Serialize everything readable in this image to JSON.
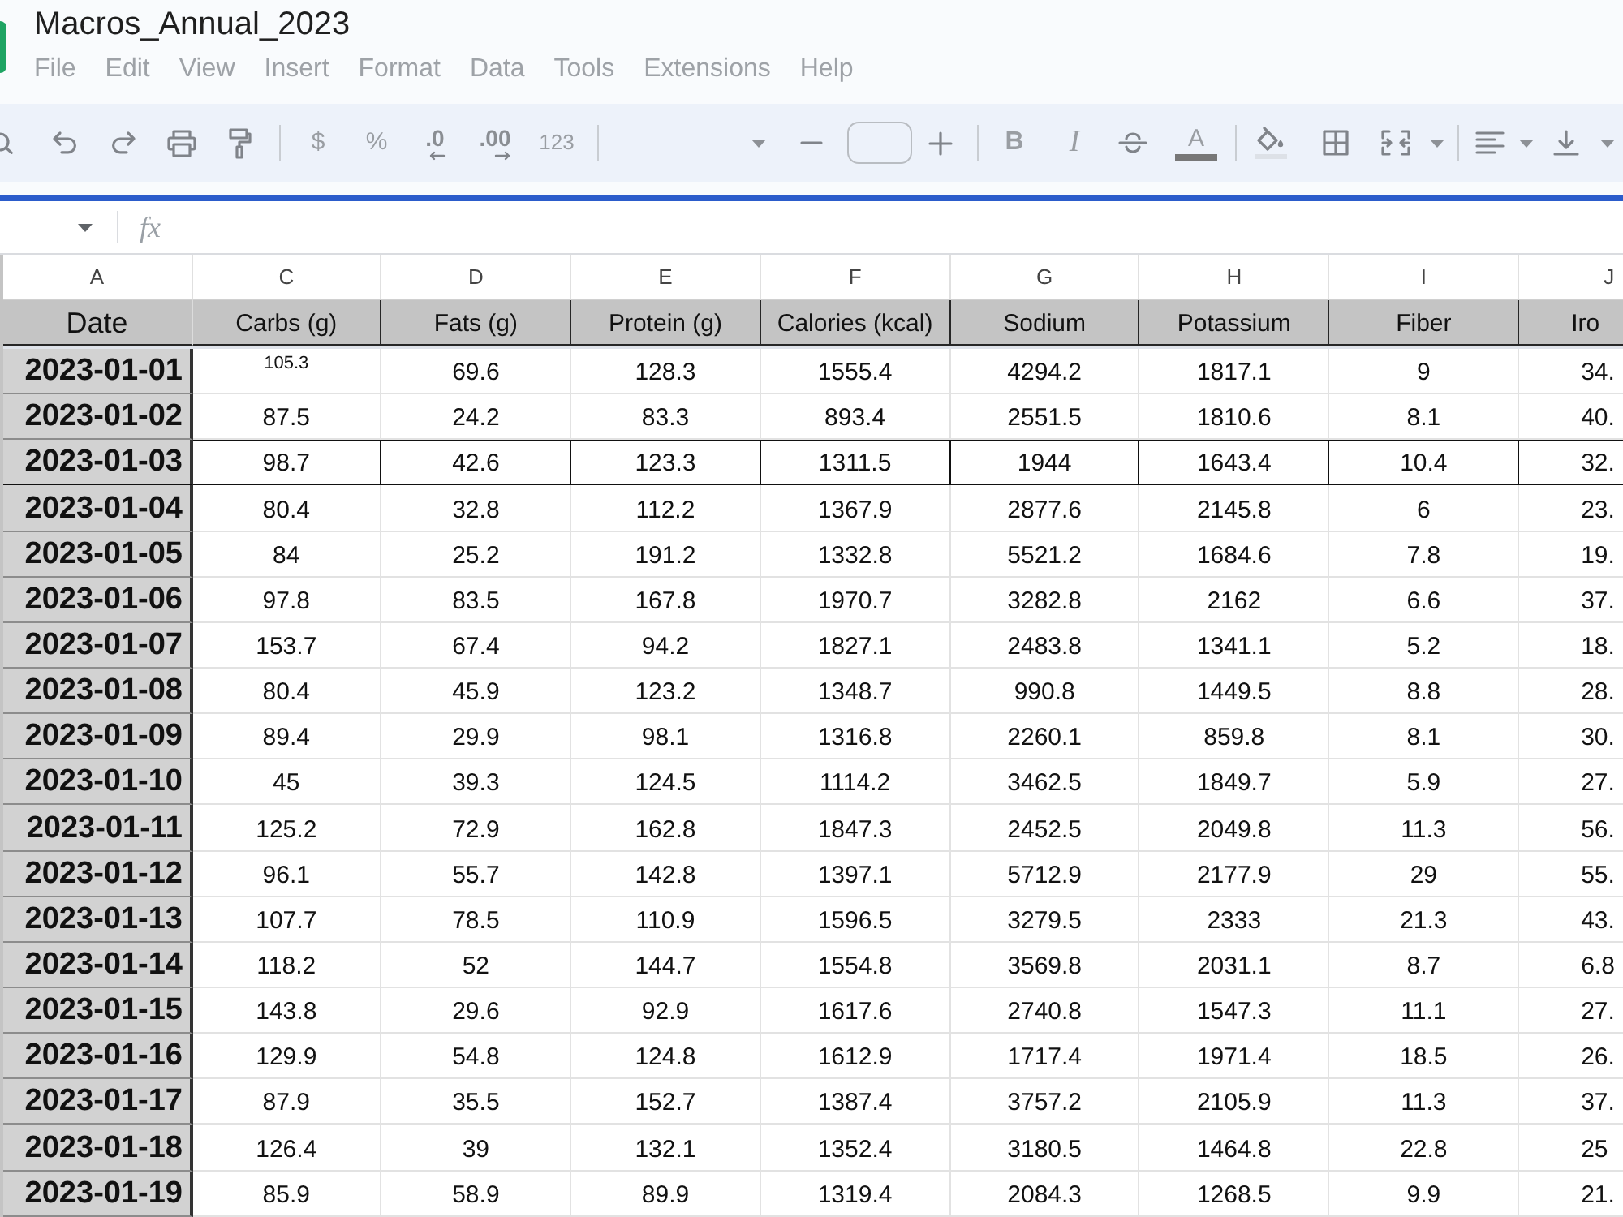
{
  "window": {
    "title": "Macros_Annual_2023"
  },
  "menu": [
    "File",
    "Edit",
    "View",
    "Insert",
    "Format",
    "Data",
    "Tools",
    "Extensions",
    "Help"
  ],
  "toolbar": {
    "currency": "$",
    "percent": "%",
    "decrease_decimal": ".0",
    "increase_decimal": ".00",
    "number_format": "123",
    "bold": "B",
    "italic": "I",
    "text_color": "A"
  },
  "formula_bar": {
    "label": "fx"
  },
  "table": {
    "columns": [
      {
        "letter": "A",
        "header": "Date"
      },
      {
        "letter": "C",
        "header": "Carbs (g)"
      },
      {
        "letter": "D",
        "header": "Fats (g)"
      },
      {
        "letter": "E",
        "header": "Protein (g)"
      },
      {
        "letter": "F",
        "header": "Calories (kcal)"
      },
      {
        "letter": "G",
        "header": "Sodium"
      },
      {
        "letter": "H",
        "header": "Potassium"
      },
      {
        "letter": "I",
        "header": "Fiber"
      },
      {
        "letter": "J",
        "header": "Iro"
      }
    ],
    "rows": [
      {
        "bordered": false,
        "cells": [
          "2023-01-01",
          {
            "text": "105.3",
            "kind": "small"
          },
          "69.6",
          "128.3",
          "1555.4",
          "4294.2",
          "1817.1",
          "9",
          "34."
        ]
      },
      {
        "bordered": false,
        "cells": [
          "2023-01-02",
          "87.5",
          "24.2",
          "83.3",
          "893.4",
          "2551.5",
          "1810.6",
          "8.1",
          "40."
        ]
      },
      {
        "bordered": true,
        "cells": [
          "2023-01-03",
          "98.7",
          "42.6",
          "123.3",
          "1311.5",
          "1944",
          "1643.4",
          "10.4",
          "32."
        ]
      },
      {
        "bordered": false,
        "cells": [
          "2023-01-04",
          "80.4",
          "32.8",
          "112.2",
          "1367.9",
          "2877.6",
          "2145.8",
          "6",
          "23."
        ]
      },
      {
        "bordered": false,
        "cells": [
          "2023-01-05",
          "84",
          "25.2",
          "191.2",
          "1332.8",
          "5521.2",
          "1684.6",
          "7.8",
          "19."
        ]
      },
      {
        "bordered": false,
        "cells": [
          "2023-01-06",
          "97.8",
          "83.5",
          "167.8",
          "1970.7",
          "3282.8",
          "2162",
          "6.6",
          "37."
        ]
      },
      {
        "bordered": false,
        "cells": [
          "2023-01-07",
          "153.7",
          "67.4",
          "94.2",
          "1827.1",
          "2483.8",
          "1341.1",
          "5.2",
          "18."
        ]
      },
      {
        "bordered": false,
        "cells": [
          "2023-01-08",
          "80.4",
          "45.9",
          "123.2",
          "1348.7",
          "990.8",
          "1449.5",
          "8.8",
          "28."
        ]
      },
      {
        "bordered": false,
        "cells": [
          "2023-01-09",
          "89.4",
          "29.9",
          "98.1",
          "1316.8",
          "2260.1",
          "859.8",
          "8.1",
          "30."
        ]
      },
      {
        "bordered": false,
        "cells": [
          "2023-01-10",
          "45",
          "39.3",
          "124.5",
          "1114.2",
          "3462.5",
          "1849.7",
          "5.9",
          "27."
        ]
      },
      {
        "bordered": false,
        "cells": [
          "2023-01-11",
          "125.2",
          "72.9",
          "162.8",
          "1847.3",
          "2452.5",
          "2049.8",
          "11.3",
          "56."
        ]
      },
      {
        "bordered": false,
        "cells": [
          "2023-01-12",
          "96.1",
          "55.7",
          "142.8",
          "1397.1",
          "5712.9",
          "2177.9",
          "29",
          "55."
        ]
      },
      {
        "bordered": false,
        "cells": [
          "2023-01-13",
          "107.7",
          "78.5",
          "110.9",
          "1596.5",
          "3279.5",
          "2333",
          "21.3",
          "43."
        ]
      },
      {
        "bordered": false,
        "cells": [
          "2023-01-14",
          "118.2",
          "52",
          "144.7",
          "1554.8",
          "3569.8",
          "2031.1",
          "8.7",
          "6.8"
        ]
      },
      {
        "bordered": false,
        "cells": [
          "2023-01-15",
          "143.8",
          "29.6",
          "92.9",
          "1617.6",
          "2740.8",
          "1547.3",
          "11.1",
          "27."
        ]
      },
      {
        "bordered": false,
        "cells": [
          "2023-01-16",
          "129.9",
          "54.8",
          "124.8",
          "1612.9",
          "1717.4",
          "1971.4",
          "18.5",
          "26."
        ]
      },
      {
        "bordered": false,
        "cells": [
          "2023-01-17",
          "87.9",
          "35.5",
          "152.7",
          "1387.4",
          "3757.2",
          "2105.9",
          "11.3",
          "37."
        ]
      },
      {
        "bordered": false,
        "cells": [
          "2023-01-18",
          "126.4",
          "39",
          "132.1",
          "1352.4",
          "3180.5",
          "1464.8",
          "22.8",
          "25"
        ]
      },
      {
        "bordered": false,
        "cells": [
          "2023-01-19",
          "85.9",
          "58.9",
          "89.9",
          "1319.4",
          "2084.3",
          "1268.5",
          "9.9",
          "21."
        ]
      }
    ]
  }
}
